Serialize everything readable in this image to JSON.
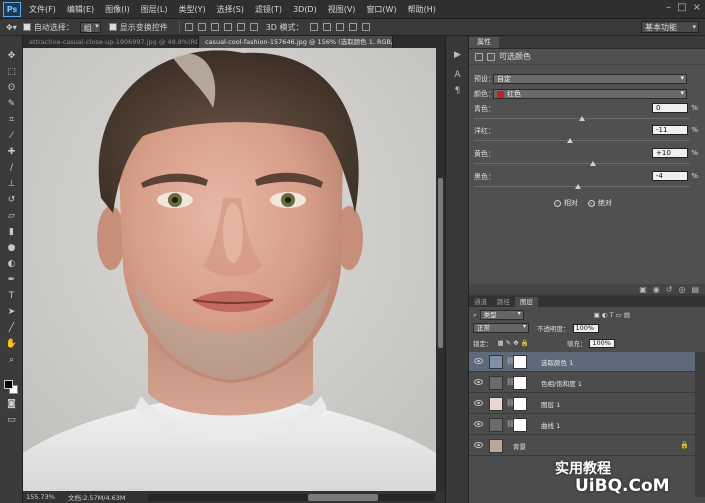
{
  "app": {
    "logo": "Ps"
  },
  "menubar": {
    "items": [
      "文件(F)",
      "编辑(E)",
      "图像(I)",
      "图层(L)",
      "类型(Y)",
      "选择(S)",
      "滤镜(T)",
      "3D(D)",
      "视图(V)",
      "窗口(W)",
      "帮助(H)"
    ],
    "window_controls": [
      "–",
      "□",
      "×"
    ]
  },
  "optionsbar": {
    "auto_select_label": "自动选择：",
    "auto_select_value": "组",
    "show_transform_label": "显示变换控件",
    "mode_3d_label": "3D 模式：",
    "workspace": "基本功能"
  },
  "doc_tabs": [
    {
      "label": "attractive-casual-close-up-1906997.jpg @ 48.8%(RGB/8)",
      "active": false
    },
    {
      "label": "casual-cool-fashion-157646.jpg @ 156% (选取颜色 1, RGB/8) *",
      "active": true
    }
  ],
  "status": {
    "zoom": "155.73%",
    "doc": "文档:2.57M/4.63M"
  },
  "toolbox": {
    "icons": [
      "move-icon",
      "marquee-icon",
      "lasso-icon",
      "quick-select-icon",
      "crop-icon",
      "eyedropper-icon",
      "healing-icon",
      "brush-icon",
      "stamp-icon",
      "history-brush-icon",
      "eraser-icon",
      "gradient-icon",
      "blur-icon",
      "dodge-icon",
      "pen-icon",
      "type-icon",
      "path-select-icon",
      "shape-icon",
      "hand-icon",
      "zoom-icon"
    ]
  },
  "properties": {
    "tab": "属性",
    "title": "可选颜色",
    "preset_label": "预设：",
    "preset_value": "自定",
    "colors_label": "颜色：",
    "colors_value": "红色",
    "sliders": [
      {
        "label": "青色：",
        "value": "0",
        "fraction": 0.5
      },
      {
        "label": "洋红：",
        "value": "-11",
        "fraction": 0.445
      },
      {
        "label": "黄色：",
        "value": "+10",
        "fraction": 0.55
      },
      {
        "label": "黑色：",
        "value": "-4",
        "fraction": 0.48
      }
    ],
    "percent": "%",
    "method_relative": "相对",
    "method_absolute": "绝对",
    "method_selected": "absolute"
  },
  "layers": {
    "tabs": [
      "通道",
      "路径",
      "图层"
    ],
    "active_tab": "图层",
    "filter_value": "类型",
    "blend_mode": "正常",
    "opacity_label": "不透明度：",
    "opacity_value": "100%",
    "lock_label": "锁定：",
    "fill_label": "填充：",
    "fill_value": "100%",
    "items": [
      {
        "name": "选取颜色 1",
        "selected": true
      },
      {
        "name": "色相/饱和度 1",
        "selected": false
      },
      {
        "name": "图层 1",
        "selected": false
      },
      {
        "name": "曲线 1",
        "selected": false
      },
      {
        "name": "背景",
        "selected": false,
        "locked": true
      }
    ]
  },
  "watermark": {
    "line1": "实用教程",
    "line2": "UiBQ.CoM"
  }
}
